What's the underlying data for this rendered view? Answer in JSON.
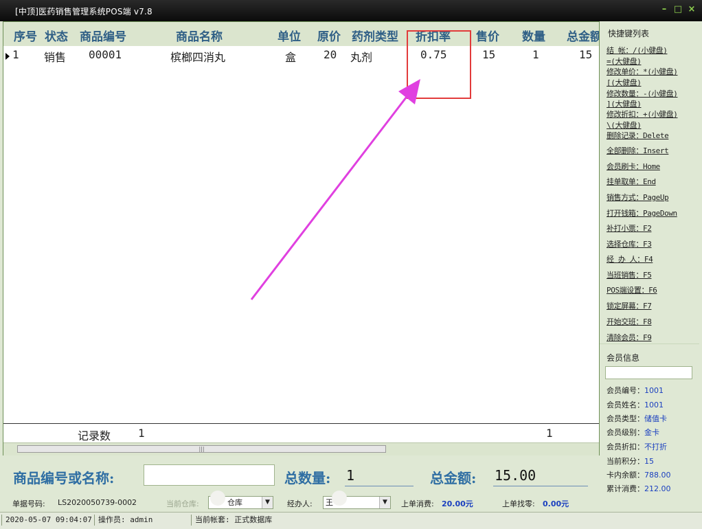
{
  "window": {
    "title": "[中顶]医药销售管理系统POS端 v7.8",
    "min_label": "–",
    "max_label": "□",
    "close_label": "×"
  },
  "grid": {
    "columns": [
      "序号",
      "状态",
      "商品编号",
      "商品名称",
      "单位",
      "原价",
      "药剂类型",
      "折扣率",
      "售价",
      "数量",
      "总金额"
    ],
    "rows": [
      {
        "seq": "1",
        "status": "销售",
        "code": "00001",
        "name": "槟榔四消丸",
        "unit": "盒",
        "price": "20",
        "type": "丸剂",
        "discount": "0.75",
        "sale_price": "15",
        "qty": "1",
        "total": "15"
      }
    ],
    "footer": {
      "record_label": "记录数",
      "record_count": "1",
      "qty_sum": "1"
    },
    "scroll_thumb": "|||"
  },
  "shortcuts": {
    "title": "快捷键列表",
    "items": [
      {
        "label": "结    帐：/(小健盘)"
      },
      {
        "label": "         =(大健盘)"
      },
      {
        "label": "修改单价：*(小健盘)"
      },
      {
        "label": "         [(大健盘)"
      },
      {
        "label": "修改数量：-(小健盘)"
      },
      {
        "label": "         ](大健盘)"
      },
      {
        "label": "修改折扣：+(小健盘)"
      },
      {
        "label": "         \\(大健盘)"
      },
      {
        "label": "删除记录：Delete"
      },
      {
        "label": "全部删除：Insert"
      },
      {
        "label": "会员刷卡：Home"
      },
      {
        "label": "挂单取单：End"
      },
      {
        "label": "销售方式：PageUp"
      },
      {
        "label": "打开钱箱：PageDown"
      },
      {
        "label": "补打小票：F2"
      },
      {
        "label": "选择仓库：F3"
      },
      {
        "label": "经 办 人：F4"
      },
      {
        "label": "当班销售：F5"
      },
      {
        "label": "POS端设置：F6"
      },
      {
        "label": "锁定屏幕：F7"
      },
      {
        "label": "开始交班：F8"
      },
      {
        "label": "清除会员：F9"
      }
    ]
  },
  "member": {
    "title": "会员信息",
    "fields": [
      {
        "label": "会员编号：",
        "value": "1001"
      },
      {
        "label": "会员姓名：",
        "value": "1001"
      },
      {
        "label": "会员类型：",
        "value": "储值卡"
      },
      {
        "label": "会员级别：",
        "value": "金卡"
      },
      {
        "label": "会员折扣：",
        "value": "不打折"
      },
      {
        "label": "当前积分：",
        "value": "15"
      },
      {
        "label": "卡内余额：",
        "value": "788.00"
      },
      {
        "label": "累计消费：",
        "value": "212.00"
      }
    ]
  },
  "entry": {
    "code_label": "商品编号或名称:",
    "code_value": "",
    "qty_label": "总数量:",
    "qty_value": "1",
    "amount_label": "总金额:",
    "amount_value": "15.00"
  },
  "info": {
    "doc_label": "单据号码:",
    "doc_value": "LS2020050739-0002",
    "warehouse_label": "当前仓库:",
    "warehouse_value": "仓库",
    "handler_label": "经办人:",
    "handler_value": "王",
    "last_spend_label": "上单消费:",
    "last_spend_value": "20.00元",
    "last_change_label": "上单找零:",
    "last_change_value": "0.00元"
  },
  "status": {
    "datetime": "2020-05-07 09:04:07",
    "operator": "操作员: admin",
    "account": "当前帐套: 正式数据库"
  },
  "colors": {
    "header_text": "#2f5f86",
    "highlight_box": "#e23a3a",
    "arrow": "#e040e0",
    "value_blue": "#1a3fbf"
  }
}
